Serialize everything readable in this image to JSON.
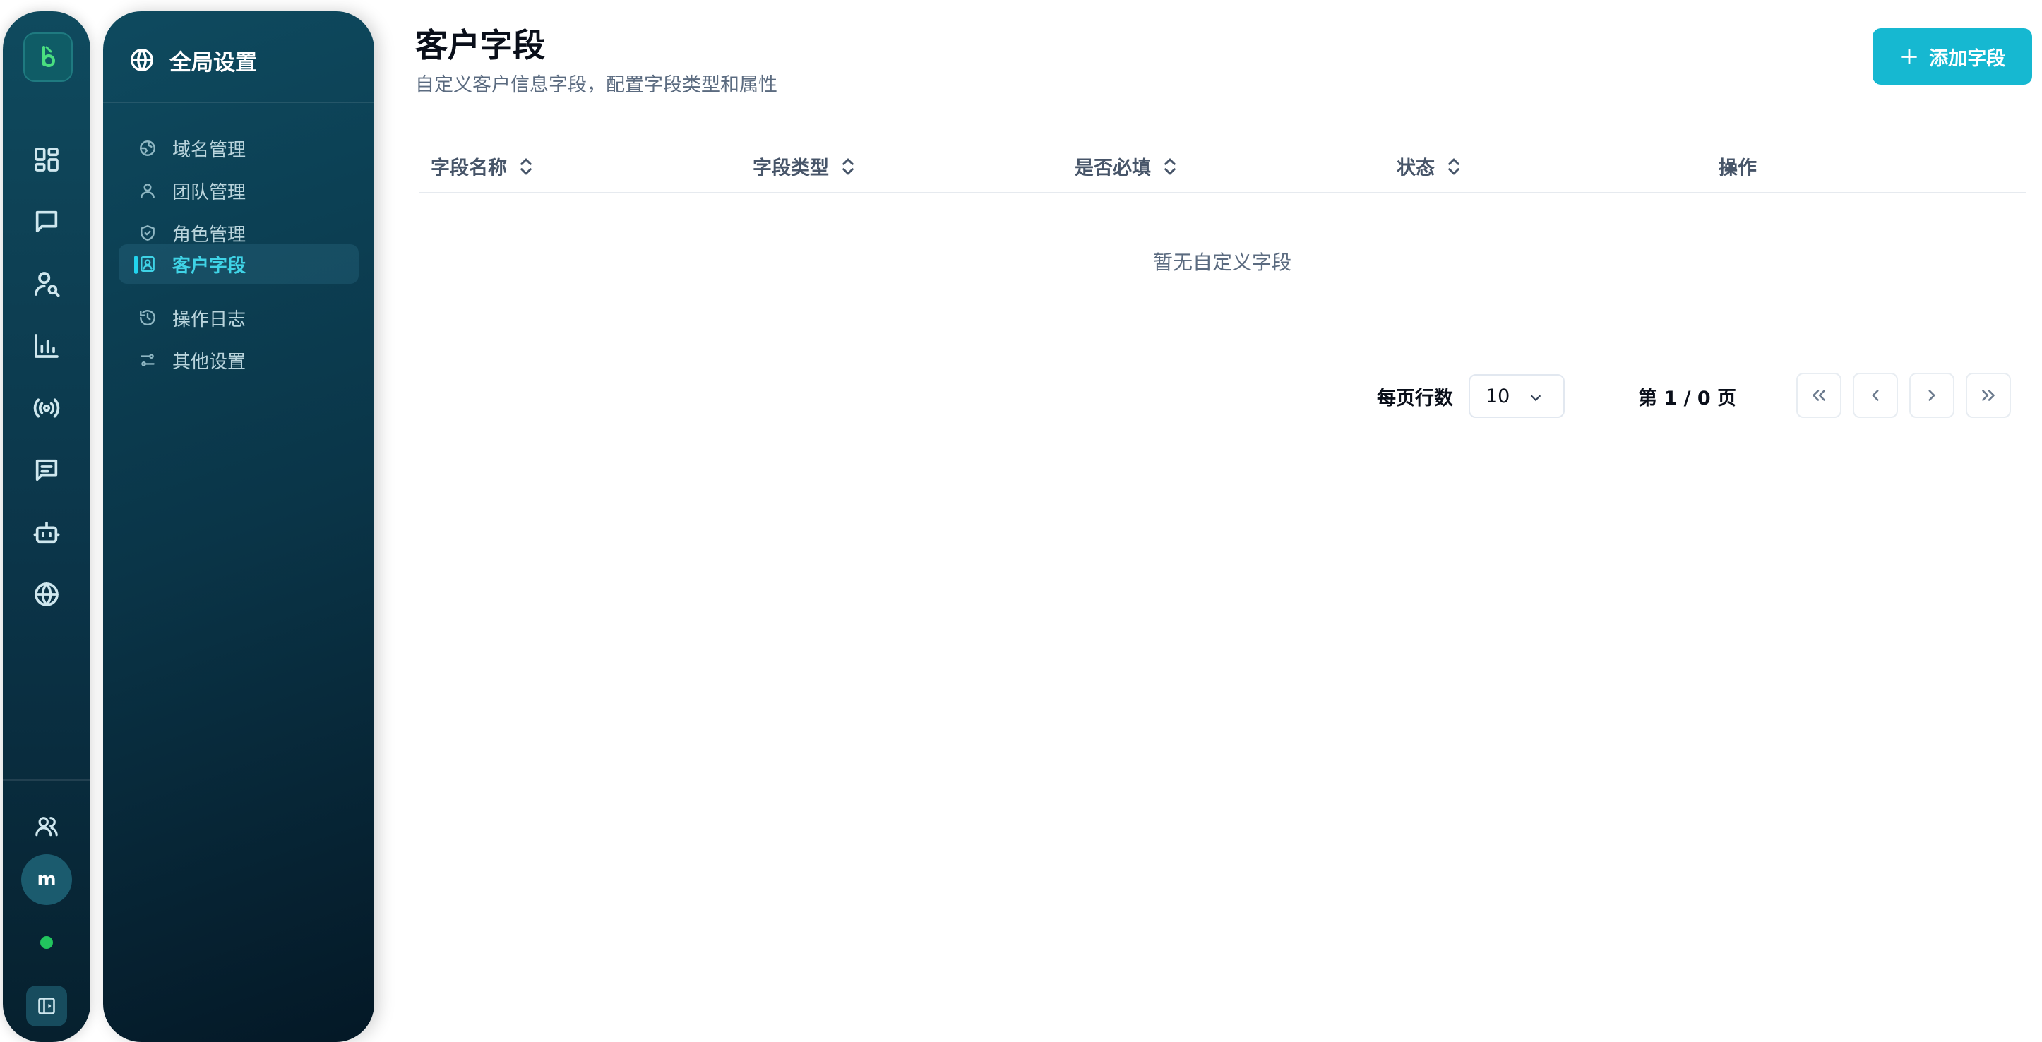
{
  "rail": {
    "icons": [
      "dashboard-icon",
      "chat-icon",
      "customer-search-icon",
      "analytics-icon",
      "broadcast-icon",
      "message-icon",
      "bot-icon",
      "globe-icon"
    ],
    "avatar_letter": "m",
    "online_color": "#22c55e"
  },
  "panel": {
    "title": "全局设置",
    "items": [
      {
        "label": "域名管理",
        "icon": "domain-globe-icon"
      },
      {
        "label": "团队管理",
        "icon": "user-icon"
      },
      {
        "label": "角色管理",
        "icon": "shield-icon"
      },
      {
        "label": "客户字段",
        "icon": "contact-card-icon",
        "active": true
      },
      {
        "label": "操作日志",
        "icon": "history-icon"
      },
      {
        "label": "其他设置",
        "icon": "sliders-icon"
      }
    ]
  },
  "page": {
    "title": "客户字段",
    "subtitle": "自定义客户信息字段，配置字段类型和属性",
    "add_button": "添加字段"
  },
  "table": {
    "columns": [
      {
        "label": "字段名称",
        "sortable": true
      },
      {
        "label": "字段类型",
        "sortable": true
      },
      {
        "label": "是否必填",
        "sortable": true
      },
      {
        "label": "状态",
        "sortable": true
      },
      {
        "label": "操作",
        "sortable": false
      }
    ],
    "empty_text": "暂无自定义字段"
  },
  "pagination": {
    "rows_label": "每页行数",
    "rows_value": "10",
    "page_info": "第 1 / 0 页"
  },
  "colors": {
    "accent": "#16b8d1",
    "active_menu": "#3fd3e6"
  }
}
